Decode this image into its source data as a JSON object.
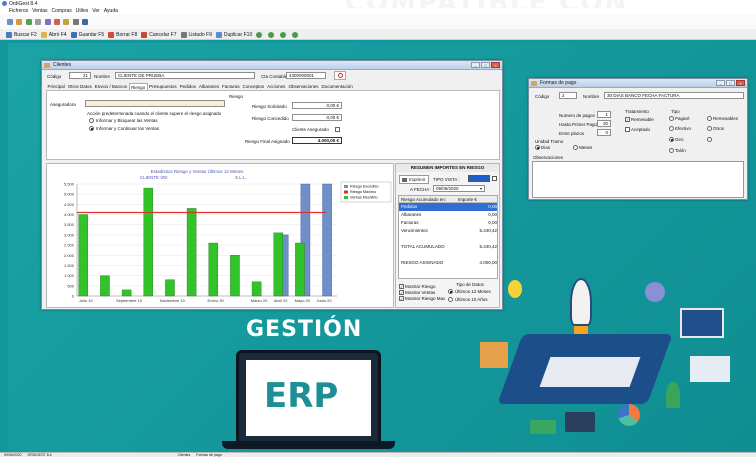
{
  "app": {
    "title": "OrdiGest 8.4",
    "banner_text": "COMPATIBLE CON"
  },
  "menu": [
    "Ficheros",
    "Ventas",
    "Compras",
    "Utiles",
    "Ver",
    "Ayuda"
  ],
  "toolbar2": [
    "Buscar F2",
    "Abrir F4",
    "Guardar F5",
    "Borrar F8",
    "Cancelar F7",
    "Listado F9",
    "Duplicar F10"
  ],
  "clientes": {
    "title": "Clientes",
    "codigo_label": "Código",
    "codigo_value": "21",
    "nombre_label": "Nombre",
    "nombre_value": "CLIENTE DE PRUEBA",
    "cta_label": "Cta Contable",
    "cta_value": "4300000001",
    "tabs": [
      "Principal",
      "Otros Datos",
      "Envios / Bancos",
      "Riesgo",
      "Presupuestos",
      "Pedidos",
      "Albaranes",
      "Facturas",
      "Conceptos",
      "Acciones",
      "Observaciones",
      "Documentación"
    ],
    "active_tab": "Riesgo",
    "aseguradora_label": "Aseguradora",
    "accion_text": "Acción predeterminada cuando el cliente supere el riesgo asignado",
    "opt1": "Informar y Bloquear las Ventas",
    "opt2": "Informar y Continuar las Ventas",
    "riesgo_group": "Riesgo",
    "solicitado_label": "Riesgo Solicitado",
    "solicitado_value": "0,00 €",
    "concedido_label": "Riesgo Concedido",
    "concedido_value": "0,00 €",
    "asegurado_label": "Cliente Asegurado",
    "final_label": "Riesgo Final Asignado",
    "final_value": "4.000,00 €"
  },
  "chart_data": {
    "type": "bar",
    "title": "Estadística Riesgo y Ventas Últimos 12 Meses",
    "subtitle_left": "CLIENTE  VEI",
    "subtitle_right": "S.L.L.",
    "categories": [
      "Julio 19",
      "Agosto 19",
      "Septiembre 19",
      "Octubre 19",
      "Noviembre 19",
      "Diciembre 19",
      "Enero 20",
      "Febrero 20",
      "Marzo 20",
      "Abril 20",
      "Mayo 20",
      "Junio 20"
    ],
    "tick_labels": [
      "Julio 19",
      "Septiembre 19",
      "Noviembre 19",
      "Enero 20",
      "Marzo 20",
      "Abril 20",
      "Mayo 20",
      "Junio 20"
    ],
    "yticks": [
      "5.500",
      "5.000",
      "4.500",
      "4.000",
      "3.500",
      "3.000",
      "2.500",
      "2.000",
      "1.500",
      "1.000",
      "500",
      "0"
    ],
    "ylim": [
      0,
      5500
    ],
    "series": [
      {
        "name": "Riesgo Excedido",
        "color": "#6f8fc9",
        "values": [
          0,
          0,
          0,
          0,
          0,
          0,
          0,
          0,
          0,
          3000,
          5500,
          5500
        ]
      },
      {
        "name": "Riesgo Máximo",
        "color": "#e53030",
        "values": [
          4100,
          4100,
          4100,
          4100,
          4100,
          4100,
          4100,
          4100,
          4100,
          4100,
          4100,
          4100
        ]
      },
      {
        "name": "Ventas Mes/Año",
        "color": "#34c22a",
        "values": [
          4000,
          1000,
          300,
          5300,
          800,
          4300,
          2600,
          2000,
          700,
          3100,
          2600,
          0
        ]
      }
    ]
  },
  "resumen": {
    "title": "RESUMEN IMPORTES EN RIESGO",
    "imprimir": "Imprimir",
    "tipo_vista_label": "TIPO VISTA :",
    "fecha_label": "A FECHA :",
    "fecha_value": "09/06/2020",
    "col1": "Riesgo Acumulado en:",
    "col2": "Importe €",
    "rows": [
      {
        "k": "Pedidos",
        "v": "0,00",
        "sel": true
      },
      {
        "k": "Albaranes",
        "v": "0,00",
        "sel": false
      },
      {
        "k": "Facturas",
        "v": "0,00",
        "sel": false
      },
      {
        "k": "Vencimientos",
        "v": "5.440,42",
        "sel": false
      },
      {
        "k": "",
        "v": "",
        "sel": false
      },
      {
        "k": "TOTAL ACUMULADO",
        "v": "5.440,42",
        "sel": false
      },
      {
        "k": "",
        "v": "",
        "sel": false
      },
      {
        "k": "RIESGO ASIGNADO",
        "v": "4.000,00",
        "sel": false
      }
    ],
    "chk1": "Mostrar Riesgo",
    "chk2": "Mostrar Ventas",
    "chk3": "Mostrar Riesgo Max",
    "tipo_datos": "Tipo de Datos",
    "r1": "Últimos 12 Meses",
    "r2": "Últimos 10 Años"
  },
  "formas": {
    "title": "Formas de pago",
    "codigo_label": "Código",
    "codigo_value": "2",
    "nombre_label": "Nombre",
    "nombre_value": "30 DIAS BANCO FECHA FACTURA",
    "npagos_label": "Numero de pagos",
    "npagos_value": "1",
    "hasta_label": "Hasta Primer Pago",
    "hasta_value": "30",
    "entre_label": "Entre plazos",
    "entre_value": "0",
    "trat_label": "Tratamiento",
    "remesable": "Remesable",
    "aceptado": "Aceptado",
    "tipo_label": "Tipo",
    "pagare": "Pagaré",
    "remesables": "Remesables",
    "efectivo": "Efectivo",
    "otros": "Otros",
    "giro": "Giro",
    "talon": "Talón",
    "unidad_label": "Unidad Tramo",
    "dias": "Dias",
    "meses": "Meses",
    "obs_label": "Observaciones"
  },
  "promo": {
    "gestion": "GESTIÓN",
    "erp": "ERP"
  },
  "statusbar": [
    "09/06/2020",
    "ORDIGEST 8.4",
    "Clientes",
    "Formas de pago"
  ]
}
